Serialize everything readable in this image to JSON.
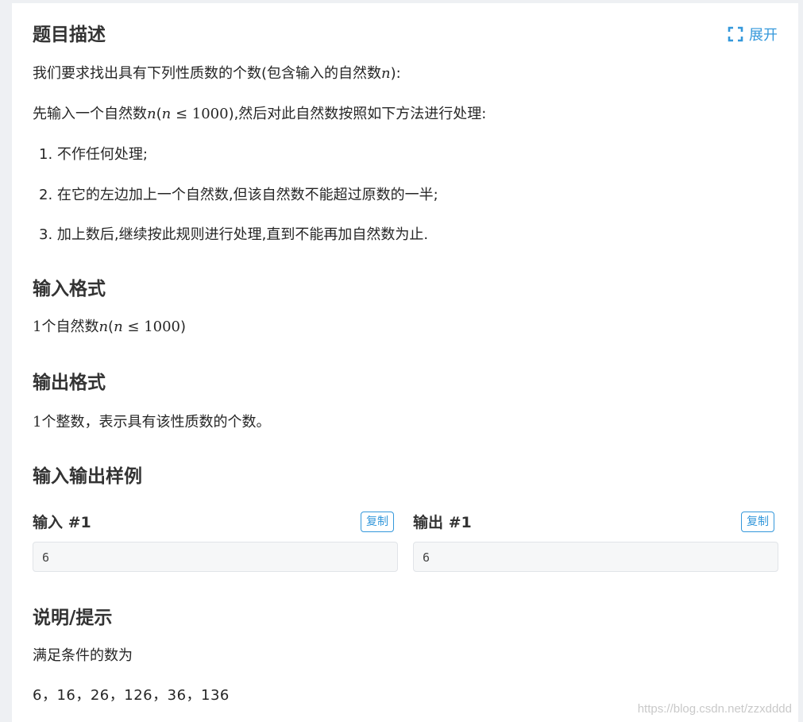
{
  "description": {
    "title": "题目描述",
    "expand_label": "展开",
    "line1_prefix": "我们要求找出具有下列性质数的个数(包含输入的自然数",
    "line1_var": "n",
    "line1_suffix": "):",
    "line2_prefix": "先输入一个自然数",
    "line2_var": "n",
    "line2_paren_open": "(",
    "line2_cond_var": "n",
    "line2_cond": " ≤ 1000",
    "line2_suffix": "),然后对此自然数按照如下方法进行处理:",
    "steps": [
      "1. 不作任何处理;",
      "2. 在它的左边加上一个自然数,但该自然数不能超过原数的一半;",
      "3. 加上数后,继续按此规则进行处理,直到不能再加自然数为止."
    ]
  },
  "input_format": {
    "title": "输入格式",
    "text_num": "1",
    "text_mid": "个自然数",
    "text_var": "n",
    "text_paren": "(",
    "text_cond_var": "n",
    "text_cond": " ≤ 1000",
    "text_close": ")"
  },
  "output_format": {
    "title": "输出格式",
    "text_num": "1",
    "text": "个整数，表示具有该性质数的个数。"
  },
  "samples": {
    "title": "输入输出样例",
    "input_label": "输入 #1",
    "output_label": "输出 #1",
    "copy_label": "复制",
    "input_value": "6",
    "output_value": "6"
  },
  "hint": {
    "title": "说明/提示",
    "line1": "满足条件的数为",
    "line2": "6，16，26，126，36，136"
  },
  "watermark": "https://blog.csdn.net/zzxdddd"
}
